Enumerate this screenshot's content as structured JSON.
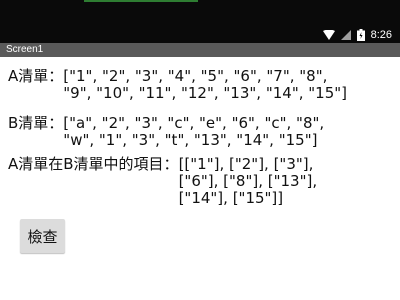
{
  "status_bar": {
    "time": "8:26"
  },
  "app_bar": {
    "title": "Screen1"
  },
  "list_a": {
    "label": "A清單：",
    "value": "[\"1\", \"2\", \"3\", \"4\", \"5\", \"6\", \"7\", \"8\", \"9\", \"10\", \"11\", \"12\", \"13\", \"14\", \"15\"]"
  },
  "list_b": {
    "label": "B清單：",
    "value": "[\"a\", \"2\", \"3\", \"c\", \"e\", \"6\", \"c\", \"8\", \"w\", \"1\", \"3\", \"t\", \"13\", \"14\", \"15\"]"
  },
  "result": {
    "label": "A清單在B清單中的項目：",
    "value": "[[\"1\"], [\"2\"], [\"3\"], [\"6\"], [\"8\"], [\"13\"], [\"14\"], [\"15\"]]"
  },
  "check_button": {
    "label": "檢查"
  },
  "icons": [
    "wifi-icon",
    "signal-icon",
    "battery-icon"
  ],
  "colors": {
    "status_bar": "#0a0a0a",
    "app_bar": "#5a5a5a",
    "accent": "#2e7d32",
    "button": "#dcdcdc"
  }
}
